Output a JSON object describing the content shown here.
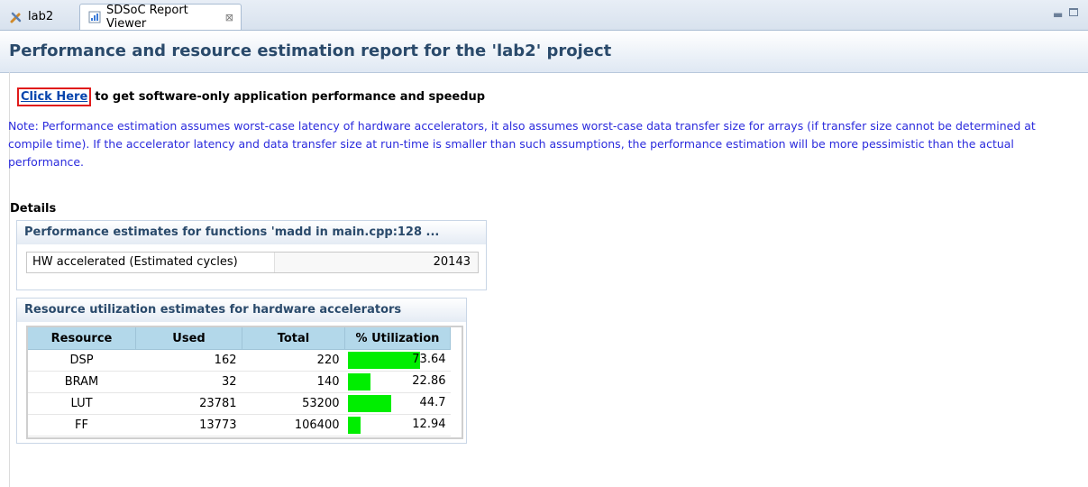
{
  "tabs": [
    {
      "label": "lab2",
      "active": false
    },
    {
      "label": "SDSoC Report Viewer",
      "active": true
    }
  ],
  "header": {
    "title": "Performance and resource estimation report for the 'lab2' project"
  },
  "link": {
    "label": "Click Here",
    "rest": "to get software-only application performance and speedup"
  },
  "note": "Note: Performance estimation assumes worst-case latency of hardware accelerators, it also assumes worst-case data transfer size for arrays (if transfer size cannot be determined at compile time). If the accelerator latency and data transfer size at run-time is smaller than such assumptions, the performance estimation will be more pessimistic than the actual performance.",
  "details_label": "Details",
  "performance": {
    "title": "Performance estimates for functions 'madd in main.cpp:128 ...",
    "row_label": "HW accelerated (Estimated cycles)",
    "row_value": "20143"
  },
  "resources": {
    "title": "Resource utilization estimates for hardware accelerators",
    "headers": [
      "Resource",
      "Used",
      "Total",
      "% Utilization"
    ],
    "rows": [
      {
        "resource": "DSP",
        "used": "162",
        "total": "220",
        "util": "73.64",
        "fraction": 0.7364
      },
      {
        "resource": "BRAM",
        "used": "32",
        "total": "140",
        "util": "22.86",
        "fraction": 0.2286
      },
      {
        "resource": "LUT",
        "used": "23781",
        "total": "53200",
        "util": "44.7",
        "fraction": 0.447
      },
      {
        "resource": "FF",
        "used": "13773",
        "total": "106400",
        "util": "12.94",
        "fraction": 0.1294
      }
    ],
    "bar_color": "#00ee00"
  },
  "icons": {
    "lab2_tab": "tools-icon",
    "report_tab": "report-icon",
    "close": "close-icon",
    "minimize": "minimize-icon",
    "maximize": "maximize-icon"
  }
}
